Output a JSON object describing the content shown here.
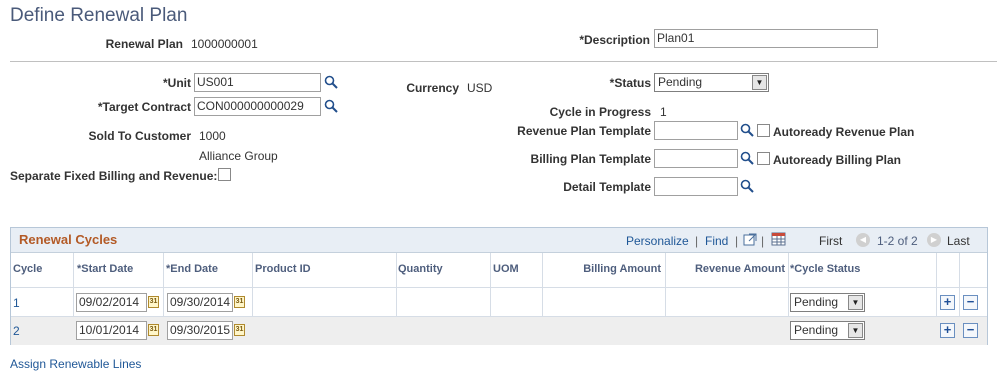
{
  "page": {
    "title": "Define Renewal Plan"
  },
  "header": {
    "renewal_plan_label": "Renewal Plan",
    "renewal_plan_value": "1000000001",
    "description_label": "*Description",
    "description_value": "Plan01"
  },
  "form": {
    "unit_label": "*Unit",
    "unit_value": "US001",
    "target_contract_label": "*Target Contract",
    "target_contract_value": "CON000000000029",
    "sold_to_label": "Sold To Customer",
    "sold_to_value": "1000",
    "sold_to_name": "Alliance Group",
    "separate_label": "Separate Fixed Billing and Revenue:",
    "currency_label": "Currency",
    "currency_value": "USD",
    "status_label": "*Status",
    "status_value": "Pending",
    "cycle_in_progress_label": "Cycle in Progress",
    "cycle_in_progress_value": "1",
    "revenue_plan_template_label": "Revenue Plan Template",
    "revenue_plan_template_value": "",
    "autoready_revenue_label": "Autoready Revenue Plan",
    "billing_plan_template_label": "Billing Plan Template",
    "billing_plan_template_value": "",
    "autoready_billing_label": "Autoready Billing Plan",
    "detail_template_label": "Detail Template",
    "detail_template_value": ""
  },
  "grid": {
    "title": "Renewal Cycles",
    "personalize": "Personalize",
    "separator1": "|",
    "find": "Find",
    "separator2": "|",
    "first": "First",
    "range": "1-2 of 2",
    "last": "Last",
    "columns": {
      "cycle": "Cycle",
      "start_date": "*Start Date",
      "end_date": "*End Date",
      "product_id": "Product ID",
      "quantity": "Quantity",
      "uom": "UOM",
      "billing_amount": "Billing Amount",
      "revenue_amount": "Revenue Amount",
      "cycle_status": "*Cycle Status"
    },
    "rows": [
      {
        "cycle": "1",
        "start_date": "09/02/2014",
        "end_date": "09/30/2014",
        "status": "Pending"
      },
      {
        "cycle": "2",
        "start_date": "10/01/2014",
        "end_date": "09/30/2015",
        "status": "Pending"
      }
    ],
    "calendar_glyph": "31",
    "add_glyph": "+",
    "delete_glyph": "−"
  },
  "footer": {
    "assign_link": "Assign Renewable Lines"
  },
  "colors": {
    "title": "#4a5a7a",
    "link": "#1f5797",
    "grid_title": "#b35a26",
    "grid_header_bg": "#e8eef5",
    "alt_row_bg": "#eeeeee"
  }
}
